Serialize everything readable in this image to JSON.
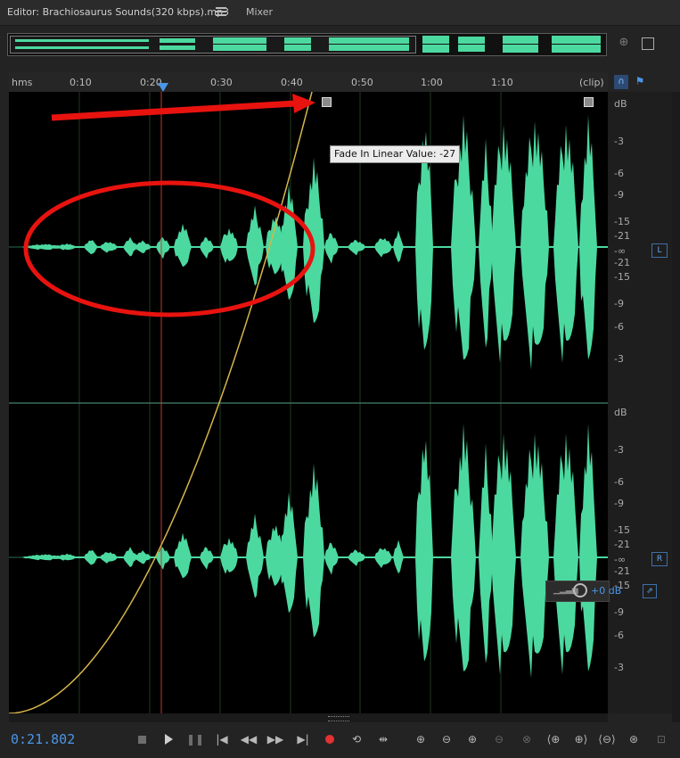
{
  "tabs": {
    "editor_label": "Editor: Brachiosaurus Sounds(320  kbps).mp3",
    "mixer_label": "Mixer"
  },
  "ruler": {
    "format_label": "hms",
    "ticks": [
      "0:10",
      "0:20",
      "0:30",
      "0:40",
      "0:50",
      "1:00",
      "1:10"
    ],
    "clip_label": "(clip)"
  },
  "db_scale": {
    "unit": "dB",
    "top_channel": [
      "dB",
      "-3",
      "-6",
      "-9",
      "-15",
      "-21",
      "-∞",
      "-21",
      "-15",
      "-9",
      "-6",
      "-3"
    ],
    "bottom_channel": [
      "dB",
      "-3",
      "-6",
      "-9",
      "-15",
      "-21",
      "-∞",
      "-21",
      "-15",
      "-9",
      "-6",
      "-3"
    ],
    "left_channel_badge": "L",
    "right_channel_badge": "R"
  },
  "tooltip": {
    "text": "Fade In Linear Value: -27"
  },
  "volume": {
    "value": "+0 dB"
  },
  "status": {
    "current_time": "0:21.802"
  },
  "colors": {
    "waveform": "#4cd9a0",
    "fade_curve": "#d6b54a",
    "playhead": "#c0392b",
    "annotation": "#e8130f",
    "accent": "#4a96e8"
  },
  "icons": {
    "transport": [
      "stop-icon",
      "play-icon",
      "pause-icon",
      "skip-start-icon",
      "rewind-icon",
      "fast-forward-icon",
      "skip-end-icon",
      "record-icon",
      "loop-icon",
      "skip-selection-icon"
    ],
    "zoom": [
      "zoom-in-amplitude-icon",
      "zoom-out-amplitude-icon",
      "zoom-in-time-icon",
      "zoom-out-time-icon",
      "zoom-full-icon",
      "zoom-in-left-icon",
      "zoom-in-right-icon",
      "zoom-out-full-icon",
      "zoom-reset-icon",
      "zoom-fit-icon"
    ]
  }
}
